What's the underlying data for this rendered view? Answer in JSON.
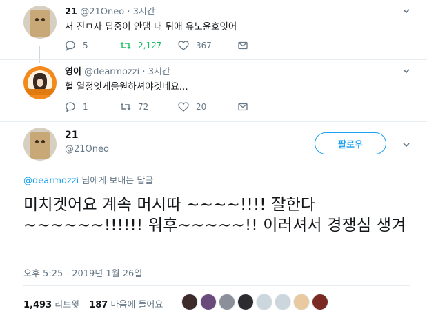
{
  "tweets": [
    {
      "name": "21",
      "handle": "@21Oneo",
      "time": "3시간",
      "text": "저 진ㅁ자 딥중이 안댐 내 뒤애 유노윤호잇어",
      "replies": "5",
      "retweets": "2,127",
      "likes": "367",
      "avatar_icon": "paper-bag-avatar-icon"
    },
    {
      "name": "영이",
      "handle": "@dearmozzi",
      "time": "3시간",
      "text": "헐 열정잇게응원하셔야겟네요...",
      "replies": "1",
      "retweets": "72",
      "likes": "20",
      "avatar_icon": "orange-ring-avatar-icon"
    }
  ],
  "main_tweet": {
    "name": "21",
    "handle": "@21Oneo",
    "follow_label": "팔로우",
    "reply_mention": "@dearmozzi",
    "reply_suffix": "님에게 보내는 답글",
    "text": "미치겟어요 계속 머시따 ~~~~!!!! 잘한다 ~~~~~~!!!!!! 워후~~~~~!! 이러셔서 경쟁심 생겨",
    "timestamp": "오후 5:25 - 2019년 1월 26일",
    "retweet_count": "1,493",
    "retweet_label": "리트윗",
    "like_count": "187",
    "like_label": "마음에 들어요",
    "liker_colors": [
      "#3d2b2b",
      "#6a4a7a",
      "#8a8f99",
      "#2b2b30",
      "#ccd6dd",
      "#ccd6dd",
      "#e8c9a0",
      "#7a2a22"
    ]
  },
  "colors": {
    "accent": "#1da1f2",
    "retweet_green": "#17bf63",
    "muted": "#657786"
  },
  "icons": [
    "reply-icon",
    "retweet-icon",
    "like-icon",
    "dm-icon",
    "chevron-down-icon"
  ]
}
